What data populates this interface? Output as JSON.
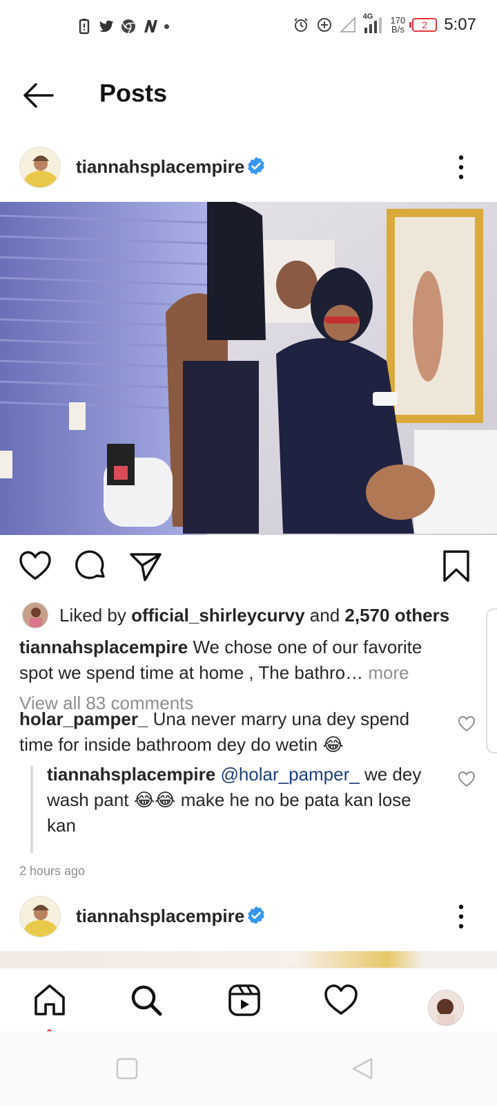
{
  "status_bar": {
    "time": "5:07",
    "net_speed_value": "170",
    "net_speed_unit": "B/s",
    "network_type": "4G",
    "battery_level": "2",
    "left_icons": [
      "battery-saver-icon",
      "twitter-icon",
      "chrome-icon",
      "n-app-icon",
      "notification-dot"
    ],
    "right_icons": [
      "alarm-icon",
      "add-circle-icon",
      "signal-empty-icon",
      "signal-4g-icon",
      "battery-low-icon"
    ]
  },
  "header": {
    "title": "Posts"
  },
  "post": {
    "username": "tiannahsplacempire",
    "verified": true,
    "likes": {
      "prefix": "Liked by",
      "user": "official_shirleycurvy",
      "and": "and",
      "others": "2,570 others"
    },
    "caption": {
      "username": "tiannahsplacempire",
      "text": "We chose one of our favorite spot we spend time at home , The bathro…",
      "more": "more"
    },
    "view_comments": "View all 83 comments",
    "comments": [
      {
        "username": "holar_pamper_",
        "text": "Una never marry una dey spend time for inside bathroom dey do wetin 😂"
      }
    ],
    "reply": {
      "username": "tiannahsplacempire",
      "mention": "@holar_pamper_",
      "text": "we dey wash pant 😂😂 make he no be pata kan lose kan"
    },
    "timestamp": "2 hours ago"
  },
  "next_post": {
    "username": "tiannahsplacempire",
    "verified": true
  },
  "colors": {
    "verified_blue": "#3897f0",
    "mention_blue": "#1c3f78",
    "muted_gray": "#8e8e8e",
    "text": "#262626",
    "notification_red": "#ed4956"
  },
  "bottom_nav": {
    "items": [
      "home-icon",
      "search-icon",
      "reels-icon",
      "activity-heart-icon",
      "profile-avatar"
    ]
  }
}
